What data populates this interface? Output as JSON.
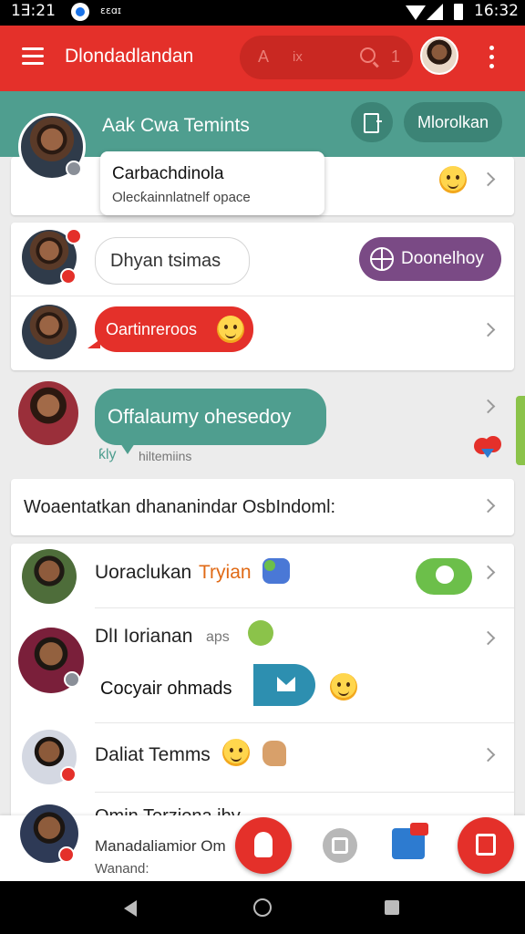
{
  "status_bar": {
    "time_left": "1Ǝ:21",
    "app_text": "ɛɛɑɪ",
    "time_right": "16:32"
  },
  "app_bar": {
    "title": "Dlondadlandan",
    "search_letter": "A",
    "search_text": "ix",
    "search_count": "1"
  },
  "teal_bar": {
    "title": "Aak Cwa Temints",
    "action_label": "Mlorolkan"
  },
  "popup": {
    "title": "Carbachdinola",
    "subtitle": "Olecƙainnlatnelf opace"
  },
  "rows": [
    {
      "bubble": "Dhyan tsimas",
      "action": "Doonelhoy"
    },
    {
      "bubble": "Oartinreroos"
    },
    {
      "bubble": "Offalaumy ohesedoy",
      "note_a": "ƙly",
      "note_b": "hiltemiins"
    }
  ],
  "section_row": {
    "text": "Woaentatkan dhananindar OsbIndoml:"
  },
  "list": [
    {
      "name": "Uoraclukan",
      "name_accent": "Tryian"
    },
    {
      "name": "DlI Iorianan",
      "name_small": "aps",
      "sub": "Cocyair ohmads"
    },
    {
      "name": "Daliat Temms"
    },
    {
      "name": "Omin Terziona ihy",
      "preview_1": "Manadaliamior Om",
      "preview_2": "Wanand:"
    }
  ],
  "colors": {
    "brand_red": "#e4302a",
    "teal": "#4f9e8f",
    "purple": "#7a4a85",
    "accent_orange": "#e06a16"
  },
  "icons": [
    "menu-icon",
    "search-icon",
    "more-vert-icon",
    "tablet-icon",
    "chevron-right-icon",
    "emoji-icon",
    "globe-icon",
    "heart-chat-icon",
    "chat-bubble-icon",
    "mail-icon",
    "compose-icon",
    "back-icon",
    "home-icon",
    "recents-icon"
  ]
}
